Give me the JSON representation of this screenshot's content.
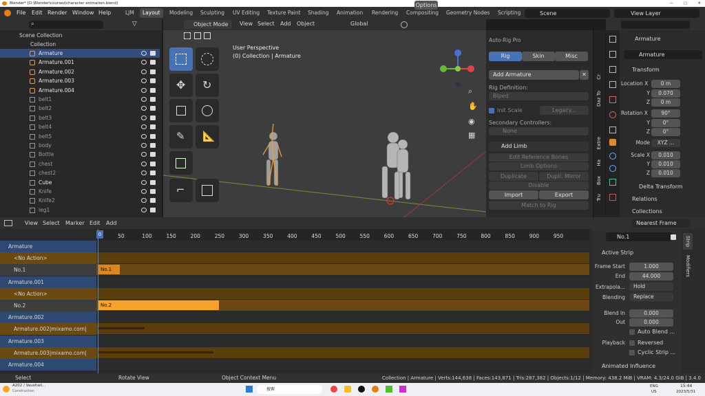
{
  "window": {
    "title": "Blender* [D:\\Blender\\courses\\character animation.blend]"
  },
  "menu": {
    "file": "File",
    "edit": "Edit",
    "render": "Render",
    "window": "Window",
    "help": "Help"
  },
  "workspaces": [
    "LJM",
    "Layout",
    "Modeling",
    "Sculpting",
    "UV Editing",
    "Texture Paint",
    "Shading",
    "Animation",
    "Rendering",
    "Compositing",
    "Geometry Nodes",
    "Scripting"
  ],
  "scene": {
    "name": "Scene",
    "view_layer": "View Layer"
  },
  "outliner": {
    "root": "Scene Collection",
    "collection": "Collection",
    "items": [
      {
        "name": "Armature",
        "type": "armature",
        "selected": true
      },
      {
        "name": "Armature.001",
        "type": "armature"
      },
      {
        "name": "Armature.002",
        "type": "armature"
      },
      {
        "name": "Armature.003",
        "type": "armature"
      },
      {
        "name": "Armature.004",
        "type": "armature"
      },
      {
        "name": "belt1",
        "type": "mesh",
        "dim": true
      },
      {
        "name": "belt2",
        "type": "mesh",
        "dim": true
      },
      {
        "name": "belt3",
        "type": "mesh",
        "dim": true
      },
      {
        "name": "belt4",
        "type": "mesh",
        "dim": true
      },
      {
        "name": "belt5",
        "type": "mesh",
        "dim": true
      },
      {
        "name": "body",
        "type": "mesh",
        "dim": true
      },
      {
        "name": "Bottle",
        "type": "mesh",
        "dim": true
      },
      {
        "name": "chest",
        "type": "mesh",
        "dim": true
      },
      {
        "name": "chest2",
        "type": "mesh",
        "dim": true
      },
      {
        "name": "Cube",
        "type": "mesh"
      },
      {
        "name": "Knife",
        "type": "mesh",
        "dim": true
      },
      {
        "name": "Knife2",
        "type": "mesh",
        "dim": true
      },
      {
        "name": "leg1",
        "type": "mesh",
        "dim": true
      }
    ]
  },
  "viewport_header": {
    "mode": "Object Mode",
    "view": "View",
    "select": "Select",
    "add": "Add",
    "object": "Object",
    "orientation": "Global",
    "options": "Options"
  },
  "viewport": {
    "perspective": "User Perspective",
    "context": "(0) Collection | Armature"
  },
  "autorig": {
    "title": "Auto-Rig Pro",
    "tabs": [
      "Rig",
      "Skin",
      "Misc"
    ],
    "add_armature": "Add Armature",
    "rig_definition_label": "Rig Definition:",
    "rig_definition": "Biped",
    "init_scale": "Init Scale",
    "legacy": "Legacy...",
    "secondary_label": "Secondary Controllers:",
    "secondary": "None",
    "add_limb": "Add Limb",
    "edit_ref": "Edit Reference Bones",
    "limb_options": "Limb Options",
    "duplicate": "Duplicate",
    "dupli_mirror": "Dupli. Mirror",
    "disable": "Disable",
    "import": "Import",
    "export": "Export",
    "match": "Match to Rig"
  },
  "side_tabs": [
    "Cr",
    "Daz To",
    "Extre",
    "Ha",
    "Box",
    "Tru"
  ],
  "properties": {
    "object": "Armature",
    "data": "Armature",
    "transform": "Transform",
    "location_label": "Location X",
    "loc": [
      "0 m",
      "0.070",
      "0 m"
    ],
    "rotation_label": "Rotation X",
    "rot": [
      "90°",
      "0°",
      "0°"
    ],
    "mode_label": "Mode",
    "mode": "XYZ ...",
    "scale_label": "Scale X",
    "scale": [
      "0.010",
      "0.010",
      "0.010"
    ],
    "y": "Y",
    "z": "Z",
    "delta": "Delta Transform",
    "relations": "Relations",
    "collections": "Collections"
  },
  "nla_header": {
    "view": "View",
    "select": "Select",
    "marker": "Marker",
    "edit": "Edit",
    "add": "Add",
    "snap": "Nearest Frame"
  },
  "ruler": [
    0,
    50,
    100,
    150,
    200,
    250,
    300,
    350,
    400,
    450,
    500,
    550,
    600,
    650,
    700,
    750,
    800,
    850,
    900,
    950
  ],
  "nla_tracks": [
    {
      "label": "Armature",
      "kind": "obj"
    },
    {
      "label": "<No Action>",
      "kind": "action"
    },
    {
      "label": "No.1",
      "kind": "track"
    },
    {
      "label": "Armature.001",
      "kind": "obj"
    },
    {
      "label": "<No Action>",
      "kind": "action"
    },
    {
      "label": "No.2",
      "kind": "track"
    },
    {
      "label": "Armature.002",
      "kind": "obj"
    },
    {
      "label": "Armature.002|mixamo.com|",
      "kind": "action"
    },
    {
      "label": "Armature.003",
      "kind": "obj"
    },
    {
      "label": "Armature.003|mixamo.com|",
      "kind": "action"
    },
    {
      "label": "Armature.004",
      "kind": "obj"
    }
  ],
  "nla_strips": [
    {
      "label": "No.1",
      "row": 2,
      "start": 1,
      "end": 44,
      "bright": false
    },
    {
      "label": "No.2",
      "row": 5,
      "start": 1,
      "end": 250,
      "bright": true
    }
  ],
  "strip_panel": {
    "name": "No.1",
    "active_strip": "Active Strip",
    "frame_start_label": "Frame Start",
    "frame_start": "1.000",
    "end_label": "End",
    "end": "44.000",
    "extrapolation_label": "Extrapola...",
    "extrapolation": "Hold",
    "blending_label": "Blending",
    "blending": "Replace",
    "blend_in_label": "Blend In",
    "blend_in": "0.000",
    "out_label": "Out",
    "out": "0.000",
    "auto_blend": "Auto Blend ...",
    "playback_label": "Playback",
    "reversed": "Reversed",
    "cyclic": "Cyclic Strip ...",
    "animated_influence": "Animated Influence",
    "tab_strip": "Strip",
    "tab_modifiers": "Modifiers"
  },
  "statusbar": {
    "select": "Select",
    "rotate": "Rotate View",
    "context": "Object Context Menu",
    "stats": "Collection | Armature | Verts:144,638 | Faces:143,871 | Tris:287,382 | Objects:1/12 | Memory: 438.2 MiB | VRAM: 4.3/24.0 GiB | 3.4.0"
  },
  "taskbar": {
    "weather_title": "A202 / Vauxhall...",
    "weather_sub": "Construction",
    "search": "搜索",
    "lang1": "ENG",
    "lang2": "US",
    "time": "15:44",
    "date": "2023/5/31"
  }
}
